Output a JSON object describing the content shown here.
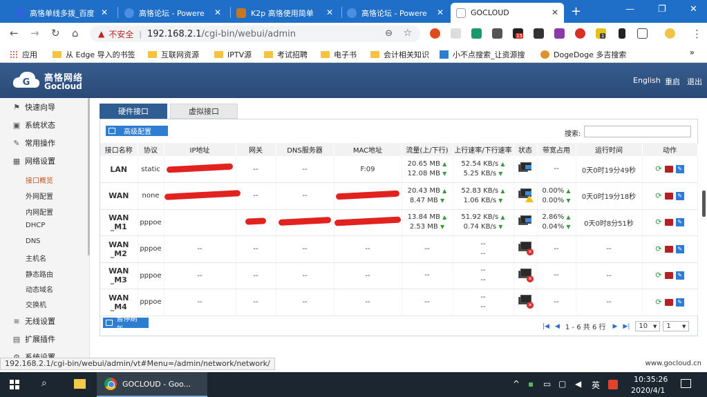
{
  "browser": {
    "tabs": [
      {
        "title": "高恪单线多拨_百度",
        "color": "#2b65d9"
      },
      {
        "title": "高恪论坛 - Powere",
        "color": "#4a90e2"
      },
      {
        "title": "K2p 高恪使用简单",
        "color": "#c9761d"
      },
      {
        "title": "高恪论坛 - Powere",
        "color": "#4a90e2"
      },
      {
        "title": "GOCLOUD",
        "color": "#888888",
        "active": true
      }
    ],
    "address": {
      "insecure_label": "不安全",
      "url_host": "192.168.2.1",
      "url_path": "/cgi-bin/webui/admin"
    },
    "extension_badge": "15",
    "extension_badge2": "1",
    "bookmarks": [
      "应用",
      "从 Edge 导入的书签",
      "互联网资源",
      "IPTV源",
      "考试招聘",
      "电子书",
      "会计相关知识",
      "小不点搜索_让资源搜",
      "DogeDoge 多吉搜索"
    ],
    "bookmarks_more": "»"
  },
  "router": {
    "brand_cn": "高恪网络",
    "brand_en": "Gocloud",
    "header_links": [
      "English",
      "重启",
      "退出"
    ],
    "menu": [
      {
        "label": "快速向导",
        "icon": "wizard-icon"
      },
      {
        "label": "系统状态",
        "icon": "monitor-icon"
      },
      {
        "label": "常用操作",
        "icon": "wrench-icon"
      },
      {
        "label": "网络设置",
        "icon": "network-icon"
      }
    ],
    "submenu": [
      "接口概览",
      "外网配置",
      "内网配置",
      "DHCP",
      "DNS",
      "主机名",
      "静态路由",
      "动态域名",
      "交换机"
    ],
    "active_submenu": "接口概览",
    "menu_bottom": [
      {
        "label": "无线设置",
        "icon": "wifi-icon"
      },
      {
        "label": "扩展插件",
        "icon": "plugin-icon"
      },
      {
        "label": "系统设置",
        "icon": "settings-icon"
      }
    ],
    "tabs": [
      "硬件接口",
      "虚拟接口"
    ],
    "advanced_button": "高级配置",
    "pause_button": "暂停刷新",
    "search_label": "搜索:",
    "search_value": "",
    "columns": [
      "接口名称",
      "协议",
      "IP地址",
      "网关",
      "DNS服务器",
      "MAC地址",
      "流量(上/下行)",
      "上行速率/下行速率",
      "状态",
      "带宽占用",
      "运行时间",
      "动作"
    ],
    "rows": [
      {
        "name": "LAN",
        "protocol": "static",
        "ip": "",
        "gateway": "--",
        "dns": "--",
        "mac": "F:09",
        "traffic_up": "20.65 MB",
        "traffic_down": "12.08 MB",
        "rate_up": "52.54 KB/s",
        "rate_down": "5.25 KB/s",
        "status": "lan",
        "bw_up": "--",
        "bw_down": "",
        "uptime": "0天0时19分49秒"
      },
      {
        "name": "WAN",
        "protocol": "none",
        "ip": "--",
        "gateway": "--",
        "dns": "--",
        "mac": "",
        "traffic_up": "20.43 MB",
        "traffic_down": "8.47 MB",
        "rate_up": "52.83 KB/s",
        "rate_down": "1.06 KB/s",
        "status": "warn",
        "bw_up": "0.00%",
        "bw_down": "0.00%",
        "uptime": "0天0时19分18秒"
      },
      {
        "name": "WAN_M1",
        "protocol": "pppoe",
        "ip": "",
        "gateway": "",
        "dns": "",
        "mac": "",
        "traffic_up": "13.84 MB",
        "traffic_down": "2.53 MB",
        "rate_up": "51.92 KB/s",
        "rate_down": "0.74 KB/s",
        "status": "ok",
        "bw_up": "2.86%",
        "bw_down": "0.04%",
        "uptime": "0天0时8分51秒"
      },
      {
        "name": "WAN_M2",
        "protocol": "pppoe",
        "ip": "--",
        "gateway": "--",
        "dns": "--",
        "mac": "--",
        "traffic_up": "--",
        "traffic_down": "",
        "rate_up": "--",
        "rate_down": "--",
        "status": "err",
        "bw_up": "--",
        "bw_down": "",
        "uptime": "--"
      },
      {
        "name": "WAN_M3",
        "protocol": "pppoe",
        "ip": "--",
        "gateway": "--",
        "dns": "--",
        "mac": "--",
        "traffic_up": "--",
        "traffic_down": "",
        "rate_up": "--",
        "rate_down": "--",
        "status": "err",
        "bw_up": "--",
        "bw_down": "",
        "uptime": "--"
      },
      {
        "name": "WAN_M4",
        "protocol": "pppoe",
        "ip": "--",
        "gateway": "--",
        "dns": "--",
        "mac": "--",
        "traffic_up": "--",
        "traffic_down": "",
        "rate_up": "--",
        "rate_down": "--",
        "status": "err",
        "bw_up": "--",
        "bw_down": "",
        "uptime": "--"
      }
    ],
    "pager": {
      "summary": "1 - 6 共 6 行",
      "page_size": "10",
      "page": "1"
    },
    "status_url": "192.168.2.1/cgi-bin/webui/admin/vt#Menu=/admin/network/network/",
    "footer_site": "www.gocloud.cn"
  },
  "taskbar": {
    "chrome_label": "GOCLOUD - Goo...",
    "ime": "英",
    "time": "10:35:26",
    "date": "2020/4/1"
  },
  "colors": {
    "header": "#2f5587",
    "accent": "#2d7dd2",
    "active_menu": "#c7511f",
    "redaction": "#e1221f"
  }
}
